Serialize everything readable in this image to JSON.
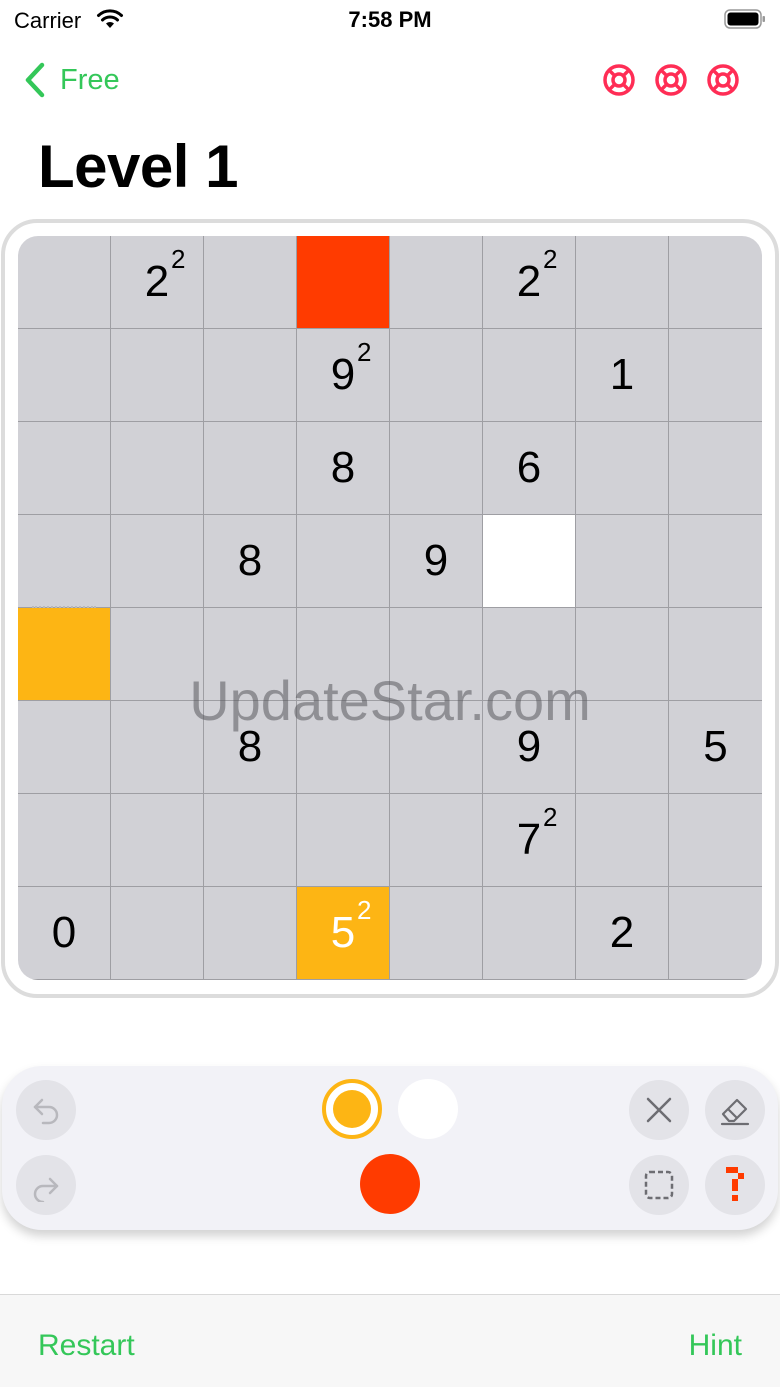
{
  "status": {
    "carrier": "Carrier",
    "time": "7:58 PM"
  },
  "nav": {
    "back_label": "Free",
    "lifebuoy_icons": [
      "lifebuoy-icon",
      "lifebuoy-icon",
      "lifebuoy-icon"
    ]
  },
  "title": "Level 1",
  "board": {
    "rows": [
      [
        {
          "v": ""
        },
        {
          "v": "2",
          "s": "2"
        },
        {
          "v": ""
        },
        {
          "v": "",
          "c": "red"
        },
        {
          "v": ""
        },
        {
          "v": "2",
          "s": "2"
        },
        {
          "v": ""
        },
        {
          "v": ""
        }
      ],
      [
        {
          "v": ""
        },
        {
          "v": ""
        },
        {
          "v": ""
        },
        {
          "v": "9",
          "s": "2"
        },
        {
          "v": ""
        },
        {
          "v": ""
        },
        {
          "v": "1"
        },
        {
          "v": ""
        }
      ],
      [
        {
          "v": ""
        },
        {
          "v": ""
        },
        {
          "v": ""
        },
        {
          "v": "8"
        },
        {
          "v": ""
        },
        {
          "v": "6"
        },
        {
          "v": ""
        },
        {
          "v": ""
        }
      ],
      [
        {
          "v": ""
        },
        {
          "v": ""
        },
        {
          "v": "8"
        },
        {
          "v": ""
        },
        {
          "v": "9"
        },
        {
          "v": "",
          "c": "white"
        },
        {
          "v": ""
        },
        {
          "v": ""
        }
      ],
      [
        {
          "v": "",
          "c": "orange"
        },
        {
          "v": ""
        },
        {
          "v": ""
        },
        {
          "v": ""
        },
        {
          "v": ""
        },
        {
          "v": ""
        },
        {
          "v": ""
        },
        {
          "v": ""
        }
      ],
      [
        {
          "v": ""
        },
        {
          "v": ""
        },
        {
          "v": "8"
        },
        {
          "v": ""
        },
        {
          "v": ""
        },
        {
          "v": "9"
        },
        {
          "v": ""
        },
        {
          "v": "5"
        }
      ],
      [
        {
          "v": ""
        },
        {
          "v": ""
        },
        {
          "v": ""
        },
        {
          "v": ""
        },
        {
          "v": ""
        },
        {
          "v": "7",
          "s": "2"
        },
        {
          "v": ""
        },
        {
          "v": ""
        }
      ],
      [
        {
          "v": "0"
        },
        {
          "v": ""
        },
        {
          "v": ""
        },
        {
          "v": "5",
          "s": "2",
          "c": "orange"
        },
        {
          "v": ""
        },
        {
          "v": ""
        },
        {
          "v": "2"
        },
        {
          "v": ""
        }
      ]
    ]
  },
  "watermark": "UpdateStar.com",
  "tools": {
    "undo_icon": "undo-icon",
    "redo_icon": "redo-icon",
    "clear_icon": "close-icon",
    "eraser_icon": "eraser-icon",
    "select_icon": "selection-icon",
    "hint_icon": "question-icon",
    "colors": {
      "orange": "#fdb514",
      "white": "#ffffff",
      "red": "#ff3b00",
      "selected": "orange"
    }
  },
  "bottom": {
    "restart_label": "Restart",
    "hint_label": "Hint"
  },
  "colors": {
    "accent": "#34c759",
    "lifebuoy": "#ff2d55",
    "cell": "#d1d1d6"
  }
}
